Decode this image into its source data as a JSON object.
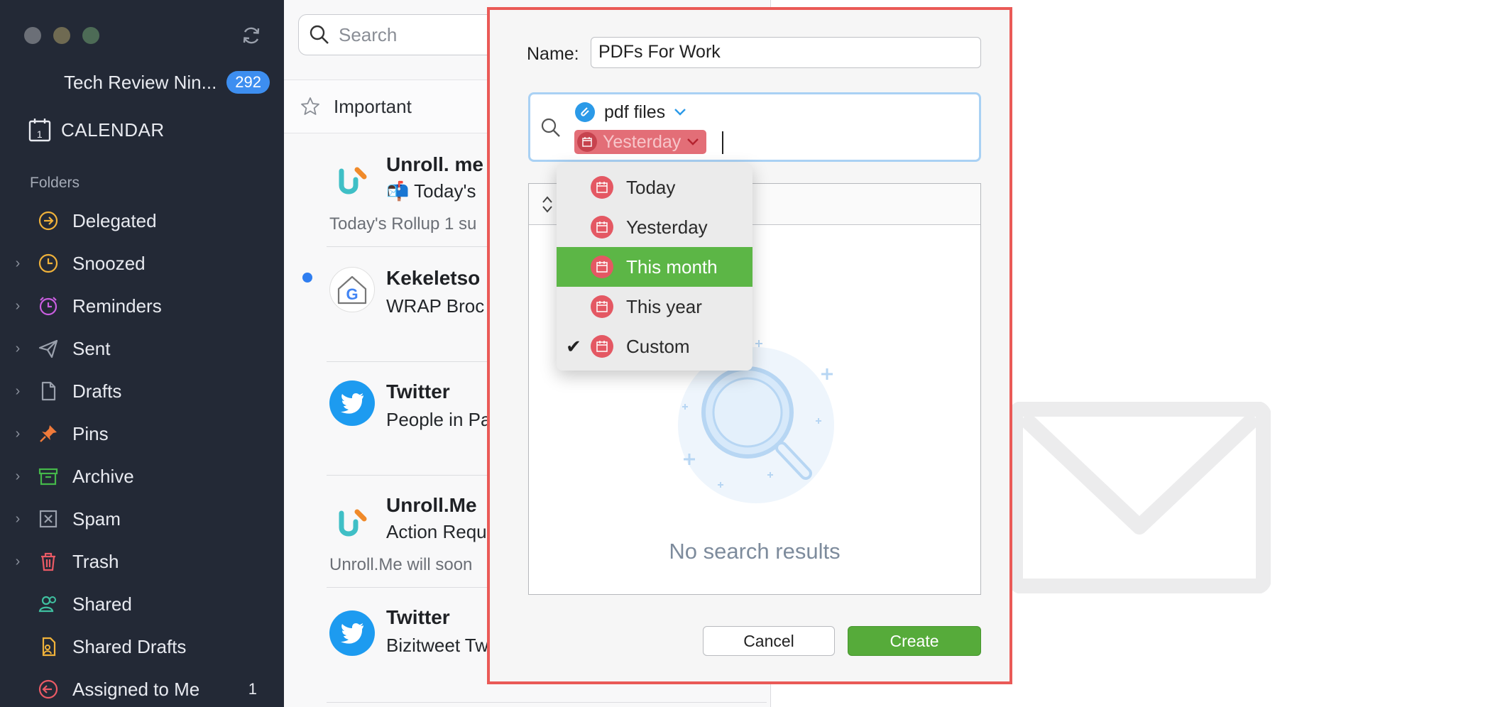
{
  "sidebar": {
    "account_name": "Tech Review Nin...",
    "account_badge": "292",
    "calendar_label": "CALENDAR",
    "folders_label": "Folders",
    "folders": [
      {
        "label": "Delegated",
        "count": "",
        "color": "#f0b23a"
      },
      {
        "label": "Snoozed",
        "count": "",
        "color": "#f0b23a"
      },
      {
        "label": "Reminders",
        "count": "",
        "color": "#c95ee0"
      },
      {
        "label": "Sent",
        "count": "",
        "color": "#9aa0ac"
      },
      {
        "label": "Drafts",
        "count": "",
        "color": "#9aa0ac"
      },
      {
        "label": "Pins",
        "count": "",
        "color": "#f07a3a"
      },
      {
        "label": "Archive",
        "count": "",
        "color": "#45b84a"
      },
      {
        "label": "Spam",
        "count": "",
        "color": "#9aa0ac"
      },
      {
        "label": "Trash",
        "count": "",
        "color": "#ea5a65"
      },
      {
        "label": "Shared",
        "count": "",
        "color": "#3fc0a0"
      },
      {
        "label": "Shared Drafts",
        "count": "",
        "color": "#f0b23a"
      },
      {
        "label": "Assigned to Me",
        "count": "1",
        "color": "#ea5a65"
      }
    ]
  },
  "message_list": {
    "search_placeholder": "Search",
    "important_label": "Important",
    "messages": [
      {
        "from": "Unroll. me",
        "subject": "📬 Today's",
        "preview": "Today's Rollup 1 su"
      },
      {
        "from": "Kekeletso",
        "subject": "WRAP Broc",
        "preview": ""
      },
      {
        "from": "Twitter",
        "subject": "People in Pa",
        "preview": ""
      },
      {
        "from": "Unroll.Me",
        "subject": "Action Requ",
        "preview": "Unroll.Me will soon"
      },
      {
        "from": "Twitter",
        "subject": "Bizitweet Tw",
        "preview": ""
      }
    ]
  },
  "dialog": {
    "name_label": "Name:",
    "name_value": "PDFs For Work",
    "query_token_files": "pdf files",
    "query_token_date": "Yesterday",
    "no_results": "No search results",
    "cancel_label": "Cancel",
    "create_label": "Create"
  },
  "date_dropdown": {
    "items": [
      {
        "label": "Today",
        "checked": false,
        "highlighted": false
      },
      {
        "label": "Yesterday",
        "checked": false,
        "highlighted": false
      },
      {
        "label": "This month",
        "checked": false,
        "highlighted": true
      },
      {
        "label": "This year",
        "checked": false,
        "highlighted": false
      },
      {
        "label": "Custom",
        "checked": true,
        "highlighted": false
      }
    ]
  },
  "colors": {
    "sidebar_bg": "#232936",
    "badge_blue": "#3d8ef0",
    "dialog_border": "#ea5a57",
    "create_green": "#56ab3a",
    "highlight_green": "#5cb646",
    "date_token_red": "#e36e77"
  }
}
